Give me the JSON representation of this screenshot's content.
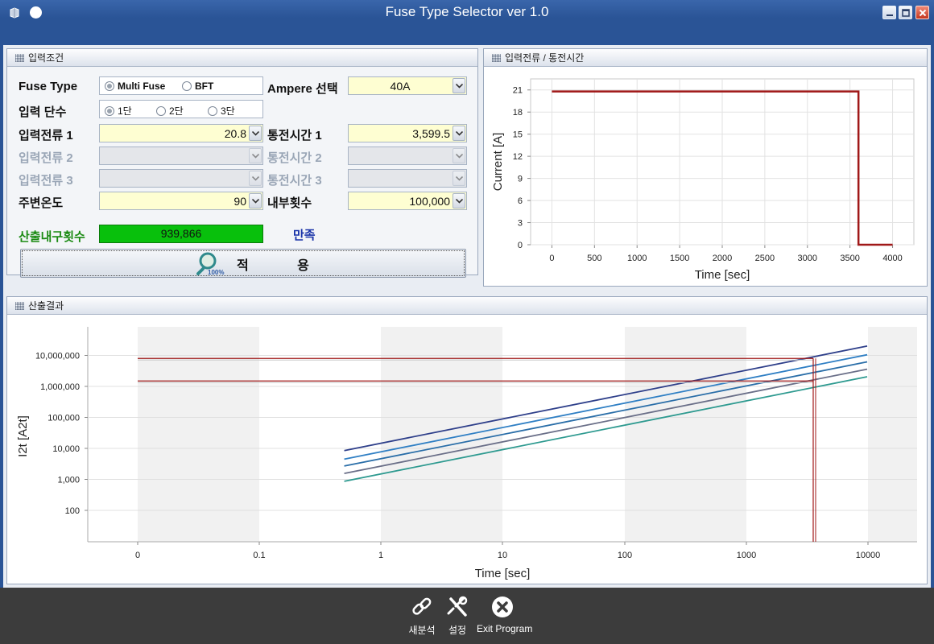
{
  "window": {
    "title": "Fuse Type Selector ver 1.0"
  },
  "input_panel": {
    "header": "입력조건",
    "fuse_type_label": "Fuse Type",
    "fuse_type_options": [
      "Multi Fuse",
      "BFT"
    ],
    "ampere_label": "Ampere 선택",
    "ampere_value": "40A",
    "stage_label": "입력 단수",
    "stage_options": [
      "1단",
      "2단",
      "3단"
    ],
    "current1_label": "입력전류 1",
    "current1_value": "20.8",
    "time1_label": "통전시간 1",
    "time1_value": "3,599.5",
    "current2_label": "입력전류 2",
    "time2_label": "통전시간 2",
    "current3_label": "입력전류 3",
    "time3_label": "통전시간 3",
    "ambient_label": "주변온도",
    "ambient_value": "90",
    "internal_label": "내부횟수",
    "internal_value": "100,000",
    "calc_label": "산출내구횟수",
    "calc_value": "939,866",
    "satisfy_text": "만족",
    "apply_label": "적 용",
    "apply_icon_badge": "100%"
  },
  "top_chart_header": "입력전류 / 통전시간",
  "bottom_chart_header": "산출결과",
  "toolbar": {
    "reanalyze_label": "새분석",
    "settings_label": "설정",
    "exit_label": "Exit Program"
  },
  "chart_data": [
    {
      "type": "line",
      "xlabel": "Time [sec]",
      "ylabel": "Current [A]",
      "xlim": [
        -250,
        4250
      ],
      "ylim": [
        0,
        22.5
      ],
      "xticks": [
        "0",
        "500",
        "1000",
        "1500",
        "2000",
        "2500",
        "3000",
        "3500",
        "4000"
      ],
      "yticks": [
        "0",
        "3",
        "6",
        "9",
        "12",
        "15",
        "18",
        "21"
      ],
      "grid": true,
      "series": [
        {
          "x": [
            0,
            3599.5,
            3599.5,
            4000
          ],
          "y": [
            20.8,
            20.8,
            0,
            0
          ],
          "color": "#a01818"
        }
      ]
    },
    {
      "type": "line",
      "xlabel": "Time [sec]",
      "ylabel": "I2t [A2t]",
      "x_scale": "log",
      "y_scale": "log",
      "xticks": [
        "0",
        "0.1",
        "1",
        "10",
        "100",
        "1000",
        "10000"
      ],
      "yticks": [
        "100",
        "1,000",
        "10,000",
        "100,000",
        "1,000,000",
        "10,000,000"
      ],
      "series": [
        {
          "x": [
            0.5,
            10000
          ],
          "y": [
            8500,
            20000000
          ],
          "color": "#2e3f8a"
        },
        {
          "x": [
            0.5,
            10000
          ],
          "y": [
            4500,
            10500000
          ],
          "color": "#2f7fc4"
        },
        {
          "x": [
            0.5,
            10000
          ],
          "y": [
            2700,
            6200000
          ],
          "color": "#2a6ea8"
        },
        {
          "x": [
            0.5,
            10000
          ],
          "y": [
            1550,
            3600000
          ],
          "color": "#6a6f88"
        },
        {
          "x": [
            0.5,
            10000
          ],
          "y": [
            870,
            2050000
          ],
          "color": "#2e9a90"
        }
      ],
      "reference_lines": {
        "horizontal": [
          8000000,
          1500000
        ],
        "vertical": 3599.5,
        "color": "#a01818"
      }
    }
  ]
}
